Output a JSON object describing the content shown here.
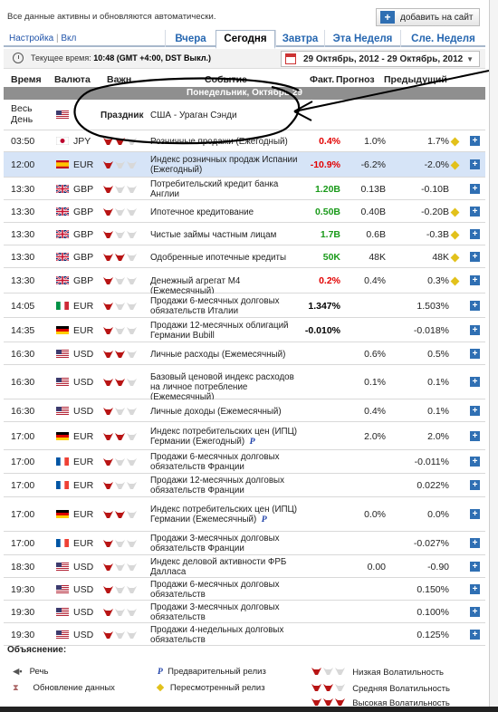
{
  "top": {
    "notice": "Все данные активны и обновляются автоматически.",
    "add_button": "добавить на сайт"
  },
  "tabs": {
    "settings": "Настройка",
    "settings_sep": " | ",
    "settings_state": "Вкл",
    "items": [
      "Вчера",
      "Сегодня",
      "Завтра",
      "Эта Неделя",
      "Сле. Неделя"
    ],
    "active": "Сегодня"
  },
  "timebar": {
    "label": "Текущее время:",
    "value": "10:48 (GMT +4:00, DST Выкл.)",
    "range": "29 Октябрь, 2012 - 29 Октябрь, 2012"
  },
  "headers": {
    "time": "Время",
    "currency": "Валюта",
    "importance": "Важн.",
    "event": "Событие",
    "actual": "Факт.",
    "forecast": "Прогноз",
    "previous": "Предыдущий"
  },
  "day_band": "Понедельник, Октябрь 29",
  "holiday": {
    "time": "Весь День",
    "label": "Праздник",
    "event": "США - Ураган Сэнди"
  },
  "rows": [
    {
      "time": "03:50",
      "flag": "jp",
      "cur": "JPY",
      "imp": 2,
      "event": "Розничные продажи (Ежегодный)",
      "actual": "0.4%",
      "acolor": "red",
      "forecast": "1.0%",
      "previous": "1.7%",
      "revised": true,
      "hl": false
    },
    {
      "time": "12:00",
      "flag": "es",
      "cur": "EUR",
      "imp": 1,
      "event": "Индекс розничных продаж Испании (Ежегодный)",
      "actual": "-10.9%",
      "acolor": "red",
      "forecast": "-6.2%",
      "previous": "-2.0%",
      "revised": true,
      "hl": true
    },
    {
      "time": "13:30",
      "flag": "gb",
      "cur": "GBP",
      "imp": 1,
      "event": "Потребительский кредит банка Англии",
      "actual": "1.20B",
      "acolor": "grn",
      "forecast": "0.13B",
      "previous": "-0.10B",
      "revised": false,
      "hl": false
    },
    {
      "time": "13:30",
      "flag": "gb",
      "cur": "GBP",
      "imp": 1,
      "event": "Ипотечное кредитование",
      "actual": "0.50B",
      "acolor": "grn",
      "forecast": "0.40B",
      "previous": "-0.20B",
      "revised": true,
      "hl": false
    },
    {
      "time": "13:30",
      "flag": "gb",
      "cur": "GBP",
      "imp": 1,
      "event": "Чистые займы частным лицам",
      "actual": "1.7B",
      "acolor": "grn",
      "forecast": "0.6B",
      "previous": "-0.3B",
      "revised": true,
      "hl": false
    },
    {
      "time": "13:30",
      "flag": "gb",
      "cur": "GBP",
      "imp": 2,
      "event": "Одобренные ипотечные кредиты",
      "actual": "50K",
      "acolor": "grn",
      "forecast": "48K",
      "previous": "48K",
      "revised": true,
      "hl": false
    },
    {
      "time": "13:30",
      "flag": "gb",
      "cur": "GBP",
      "imp": 1,
      "event": "Денежный агрегат M4 (Ежемесячный)",
      "actual": "0.2%",
      "acolor": "red",
      "forecast": "0.4%",
      "previous": "0.3%",
      "revised": true,
      "hl": false
    },
    {
      "time": "14:05",
      "flag": "it",
      "cur": "EUR",
      "imp": 1,
      "event": "Продажи 6-месячных долговых обязательств Италии",
      "actual": "1.347%",
      "acolor": "blk",
      "forecast": "",
      "previous": "1.503%",
      "revised": false,
      "hl": false
    },
    {
      "time": "14:35",
      "flag": "de",
      "cur": "EUR",
      "imp": 1,
      "event": "Продажи 12-месячных облигаций Германии Bubill",
      "actual": "-0.010%",
      "acolor": "blk",
      "forecast": "",
      "previous": "-0.018%",
      "revised": false,
      "hl": false
    },
    {
      "time": "16:30",
      "flag": "us",
      "cur": "USD",
      "imp": 2,
      "event": "Личные расходы (Ежемесячный)",
      "actual": "",
      "acolor": "blk",
      "forecast": "0.6%",
      "previous": "0.5%",
      "revised": false,
      "hl": false
    },
    {
      "time": "16:30",
      "flag": "us",
      "cur": "USD",
      "imp": 2,
      "event": "Базовый ценовой индекс расходов на личное потребление (Ежемесячный)",
      "actual": "",
      "acolor": "blk",
      "forecast": "0.1%",
      "previous": "0.1%",
      "revised": false,
      "hl": false
    },
    {
      "time": "16:30",
      "flag": "us",
      "cur": "USD",
      "imp": 1,
      "event": "Личные доходы (Ежемесячный)",
      "actual": "",
      "acolor": "blk",
      "forecast": "0.4%",
      "previous": "0.1%",
      "revised": false,
      "hl": false
    },
    {
      "time": "17:00",
      "flag": "de",
      "cur": "EUR",
      "imp": 2,
      "event": "Индекс потребительских цен (ИПЦ) Германии (Ежегодный)",
      "pmark": true,
      "actual": "",
      "acolor": "blk",
      "forecast": "2.0%",
      "previous": "2.0%",
      "revised": false,
      "hl": false
    },
    {
      "time": "17:00",
      "flag": "fr",
      "cur": "EUR",
      "imp": 1,
      "event": "Продажи 6-месячных долговых обязательств Франции",
      "actual": "",
      "acolor": "blk",
      "forecast": "",
      "previous": "-0.011%",
      "revised": false,
      "hl": false
    },
    {
      "time": "17:00",
      "flag": "fr",
      "cur": "EUR",
      "imp": 1,
      "event": "Продажи 12-месячных долговых обязательств Франции",
      "actual": "",
      "acolor": "blk",
      "forecast": "",
      "previous": "0.022%",
      "revised": false,
      "hl": false
    },
    {
      "time": "17:00",
      "flag": "de",
      "cur": "EUR",
      "imp": 2,
      "event": "Индекс потребительских цен (ИПЦ) Германии (Ежемесячный)",
      "pmark": true,
      "actual": "",
      "acolor": "blk",
      "forecast": "0.0%",
      "previous": "0.0%",
      "revised": false,
      "hl": false
    },
    {
      "time": "17:00",
      "flag": "fr",
      "cur": "EUR",
      "imp": 1,
      "event": "Продажи 3-месячных долговых обязательств Франции",
      "actual": "",
      "acolor": "blk",
      "forecast": "",
      "previous": "-0.027%",
      "revised": false,
      "hl": false
    },
    {
      "time": "18:30",
      "flag": "us",
      "cur": "USD",
      "imp": 1,
      "event": "Индекс деловой активности ФРБ Далласа",
      "actual": "",
      "acolor": "blk",
      "forecast": "0.00",
      "previous": "-0.90",
      "revised": false,
      "hl": false
    },
    {
      "time": "19:30",
      "flag": "us",
      "cur": "USD",
      "imp": 1,
      "event": "Продажи 6-месячных долговых обязательств",
      "actual": "",
      "acolor": "blk",
      "forecast": "",
      "previous": "0.150%",
      "revised": false,
      "hl": false
    },
    {
      "time": "19:30",
      "flag": "us",
      "cur": "USD",
      "imp": 1,
      "event": "Продажи 3-месячных долговых обязательств",
      "actual": "",
      "acolor": "blk",
      "forecast": "",
      "previous": "0.100%",
      "revised": false,
      "hl": false
    },
    {
      "time": "19:30",
      "flag": "us",
      "cur": "USD",
      "imp": 1,
      "event": "Продажи 4-недельных долговых обязательств",
      "actual": "",
      "acolor": "blk",
      "forecast": "",
      "previous": "0.125%",
      "revised": false,
      "hl": false
    }
  ],
  "legend": {
    "title": "Объяснение:",
    "speech": "Речь",
    "update": "Обновление данных",
    "prelim_mark": "P",
    "prelim": "Предварительный релиз",
    "revised": "Пересмотренный релиз",
    "low": "Низкая Волатильность",
    "mid": "Средняя Волатильность",
    "high": "Высокая Волатильность"
  },
  "colors": {
    "accent": "#2566b0",
    "actual_red": "#e20000",
    "actual_green": "#1a9a1a",
    "highlight": "#d6e4f7",
    "bull": "#b81414"
  }
}
